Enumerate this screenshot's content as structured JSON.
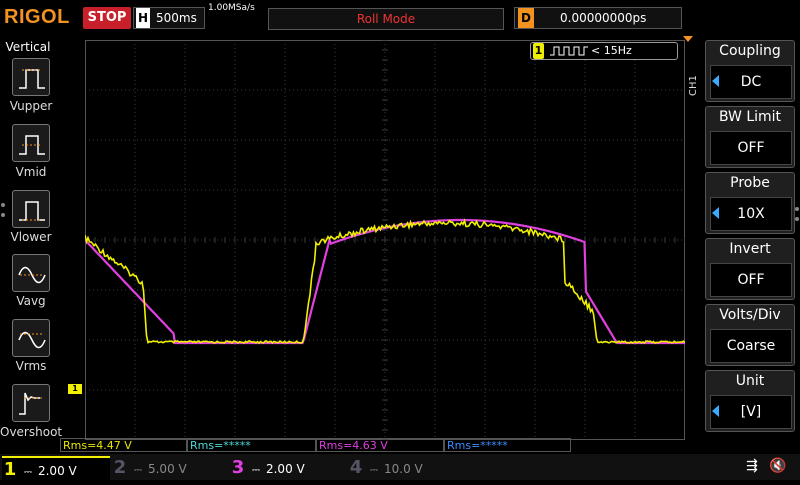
{
  "header": {
    "logo": "RIGOL",
    "run_state": "STOP",
    "timebase_label": "H",
    "timebase_value": "500ms",
    "sample_rate": "1.00MSa/s",
    "mode": "Roll Mode",
    "delay_label": "D",
    "delay_value": "0.00000000ps"
  },
  "left_panel": {
    "title": "Vertical",
    "items": [
      {
        "label": "Vupper",
        "icon": "vupper-icon"
      },
      {
        "label": "Vmid",
        "icon": "vmid-icon"
      },
      {
        "label": "Vlower",
        "icon": "vlower-icon"
      },
      {
        "label": "Vavg",
        "icon": "vavg-icon"
      },
      {
        "label": "Vrms",
        "icon": "vrms-icon"
      },
      {
        "label": "Overshoot",
        "icon": "overshoot-icon"
      }
    ]
  },
  "trigger": {
    "channel": "1",
    "text": "< 15Hz"
  },
  "channel_tag": "CH1",
  "right_menu": [
    {
      "title": "Coupling",
      "value": "DC",
      "arrow": true
    },
    {
      "title": "BW Limit",
      "value": "OFF",
      "arrow": false
    },
    {
      "title": "Probe",
      "value": "10X",
      "arrow": true
    },
    {
      "title": "Invert",
      "value": "OFF",
      "arrow": false
    },
    {
      "title": "Volts/Div",
      "value": "Coarse",
      "arrow": false
    },
    {
      "title": "Unit",
      "value": "[V]",
      "arrow": true
    }
  ],
  "measurements": [
    {
      "text": "Rms=4.47 V",
      "color": "#e8e800"
    },
    {
      "text": "Rms=*****",
      "color": "#4fd8d8"
    },
    {
      "text": "Rms=4.63 V",
      "color": "#e040e0"
    },
    {
      "text": "Rms=*****",
      "color": "#3a8cff"
    }
  ],
  "channels": [
    {
      "num": "1",
      "scale": "2.00 V",
      "color": "#f0f000",
      "active": true
    },
    {
      "num": "2",
      "scale": "5.00 V",
      "color": "#3aaaaa",
      "active": false
    },
    {
      "num": "3",
      "scale": "2.00 V",
      "color": "#e040e0",
      "active": true
    },
    {
      "num": "4",
      "scale": "10.0 V",
      "color": "#3a6ab0",
      "active": false
    }
  ],
  "colors": {
    "ch1": "#f0f000",
    "ch3": "#e040e0",
    "grid": "#3a3a3a",
    "accent": "#f29220"
  }
}
